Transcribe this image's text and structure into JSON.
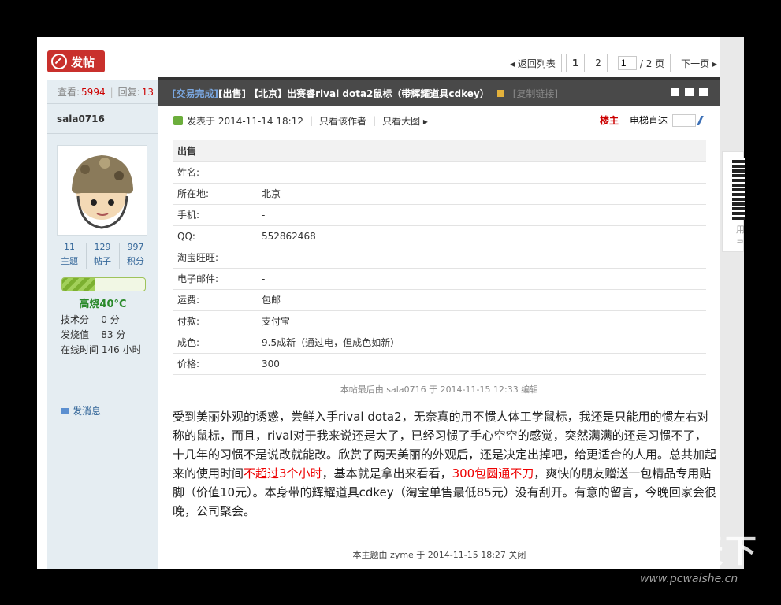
{
  "toolbar": {
    "post_label": "发帖"
  },
  "pager": {
    "back": "◂ 返回列表",
    "p1": "1",
    "p2": "2",
    "current": "1",
    "total": "/ 2 页",
    "next": "下一页 ▸"
  },
  "stats": {
    "views_label": "查看:",
    "views": "5994",
    "replies_label": "回复:",
    "replies": "13"
  },
  "user": {
    "name": "sala0716",
    "threads": "11",
    "threads_label": "主题",
    "posts": "129",
    "posts_label": "帖子",
    "credits": "997",
    "credits_label": "积分",
    "heat_progress": 0.4,
    "rank": "高烧40°C",
    "tech_label": "技术分",
    "tech": "0 分",
    "fever_label": "发烧值",
    "fever": "83 分",
    "online_label": "在线时间",
    "online": "146 小时",
    "msg": "发消息"
  },
  "thread": {
    "tag": "[交易完成]",
    "title_rest": " [出售] 【北京】出赛睿rival dota2鼠标（带辉耀道具cdkey）",
    "copy": "[复制链接]"
  },
  "post_meta": {
    "posted": "发表于 2014-11-14 18:12",
    "only_author": "只看该作者",
    "big_img": "只看大图 ▸",
    "lz": "楼主",
    "elevator": "电梯直达"
  },
  "trade": {
    "head": "出售",
    "rows": [
      {
        "k": "姓名:",
        "v": "-"
      },
      {
        "k": "所在地:",
        "v": "北京"
      },
      {
        "k": "手机:",
        "v": "-"
      },
      {
        "k": "QQ:",
        "v": "552862468"
      },
      {
        "k": "淘宝旺旺:",
        "v": "-"
      },
      {
        "k": "电子邮件:",
        "v": "-"
      },
      {
        "k": "运费:",
        "v": "包邮"
      },
      {
        "k": "付款:",
        "v": "支付宝"
      },
      {
        "k": "成色:",
        "v": "9.5成新（通过电，但成色如新）"
      },
      {
        "k": "价格:",
        "v": "300"
      }
    ]
  },
  "edited": "本帖最后由 sala0716 于 2014-11-15 12:33 编辑",
  "body": {
    "p1": "受到美丽外观的诱惑，尝鲜入手rival dota2，无奈真的用不惯人体工学鼠标，我还是只能用的惯左右对称的鼠标，而且，rival对于我来说还是大了，已经习惯了手心空空的感觉，突然满满的还是习惯不了，十几年的习惯不是说改就能改。欣赏了两天美丽的外观后，还是决定出掉吧，给更适合的人用。总共加起来的使用时间",
    "red1": "不超过3个小时",
    "p2": "，基本就是拿出来看看，",
    "red2": "300包圆通不刀",
    "p3": "，爽快的朋友赠送一包精品专用贴脚（价值10元）。本身带的辉耀道具cdkey（淘宝单售最低85元）没有刮开。有意的留言，今晚回家会很晚，公司聚会。"
  },
  "closed": "本主题由 zyme 于 2014-11-15 18:27 关闭",
  "qr": {
    "t1": "用",
    "t2": "ᄏ"
  },
  "watermark": {
    "text": "外设天下",
    "url": "www.pcwaishe.cn"
  }
}
